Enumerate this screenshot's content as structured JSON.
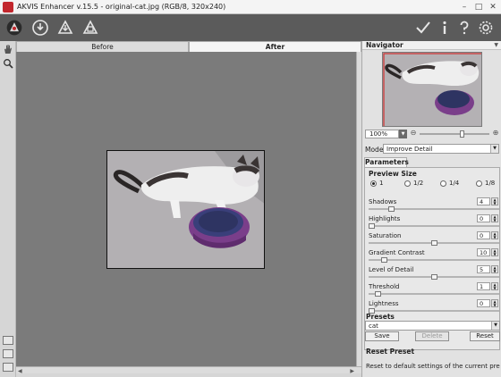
{
  "window": {
    "title": "AKVIS Enhancer v.15.5 - original-cat.jpg (RGB/8, 320x240)",
    "controls": [
      "minimize-icon",
      "maximize-icon",
      "close-icon"
    ]
  },
  "toolbar": {
    "left_icons": [
      "open-icon",
      "save-icon",
      "print-icon"
    ],
    "right_icons": [
      "apply-check-icon",
      "info-icon",
      "help-icon",
      "settings-gear-icon"
    ]
  },
  "left_tools": [
    "hand-icon",
    "zoom-icon"
  ],
  "view_tabs": {
    "before": "Before",
    "after": "After"
  },
  "navigator": {
    "title": "Navigator",
    "zoom_value": "100%",
    "zoom_minus": "⊖",
    "zoom_plus": "⊕",
    "zoom_fraction": 0.62
  },
  "mode": {
    "label": "Mode:",
    "value": "Improve Detail"
  },
  "parameters": {
    "tab_label": "Parameters",
    "preview_size": {
      "title": "Preview Size",
      "options": [
        "1",
        "1/2",
        "1/4",
        "1/8"
      ],
      "selected": "1"
    },
    "sliders": [
      {
        "label": "Shadows",
        "value": "4",
        "fraction": 0.16
      },
      {
        "label": "Highlights",
        "value": "0",
        "fraction": 0.0
      },
      {
        "label": "Saturation",
        "value": "0",
        "fraction": 0.5
      },
      {
        "label": "Gradient Contrast",
        "value": "10",
        "fraction": 0.1
      },
      {
        "label": "Level of Detail",
        "value": "5",
        "fraction": 0.5
      },
      {
        "label": "Threshold",
        "value": "1",
        "fraction": 0.05
      },
      {
        "label": "Lightness",
        "value": "0",
        "fraction": 0.0
      }
    ]
  },
  "presets": {
    "title": "Presets",
    "selected": "cat",
    "buttons": {
      "save": "Save",
      "delete": "Delete",
      "reset": "Reset"
    }
  },
  "tooltip": {
    "title": "Reset Preset",
    "text": "Reset to default settings of the current preset."
  }
}
